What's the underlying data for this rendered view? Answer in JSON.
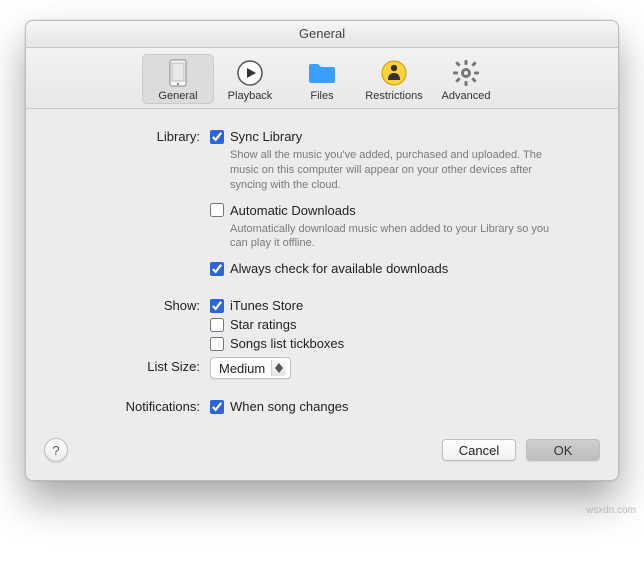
{
  "window": {
    "title": "General"
  },
  "toolbar": {
    "general": {
      "label": "General",
      "selected": true
    },
    "playback": {
      "label": "Playback",
      "selected": false
    },
    "files": {
      "label": "Files",
      "selected": false
    },
    "restrictions": {
      "label": "Restrictions",
      "selected": false
    },
    "advanced": {
      "label": "Advanced",
      "selected": false
    }
  },
  "sections": {
    "library": {
      "label": "Library:",
      "sync": {
        "label": "Sync Library",
        "checked": true,
        "desc": "Show all the music you've added, purchased and uploaded. The music on this computer will appear on your other devices after syncing with the cloud."
      },
      "auto": {
        "label": "Automatic Downloads",
        "checked": false,
        "desc": "Automatically download music when added to your Library so you can play it offline."
      },
      "check": {
        "label": "Always check for available downloads",
        "checked": true
      }
    },
    "show": {
      "label": "Show:",
      "store": {
        "label": "iTunes Store",
        "checked": true
      },
      "stars": {
        "label": "Star ratings",
        "checked": false
      },
      "ticks": {
        "label": "Songs list tickboxes",
        "checked": false
      }
    },
    "listsize": {
      "label": "List Size:",
      "value": "Medium"
    },
    "notifications": {
      "label": "Notifications:",
      "song": {
        "label": "When song changes",
        "checked": true
      }
    }
  },
  "footer": {
    "help": "?",
    "cancel": "Cancel",
    "ok": "OK"
  },
  "watermark": "wsxdn.com"
}
